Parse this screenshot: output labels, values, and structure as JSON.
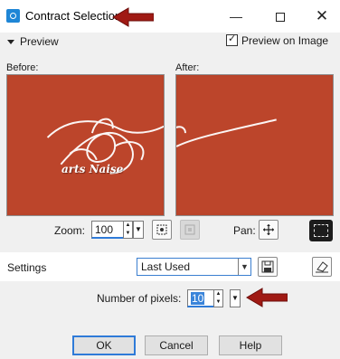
{
  "window": {
    "title": "Contract Selection",
    "minimize_glyph": "—",
    "close_glyph": "✕"
  },
  "preview": {
    "toggle_label": "Preview",
    "preview_on_image_label": "Preview on Image",
    "preview_on_image_checked": true
  },
  "panels": {
    "before_label": "Before:",
    "after_label": "After:",
    "watermark_text": "arts Naise",
    "image_color": "#bc452b"
  },
  "zoom": {
    "label": "Zoom:",
    "value": "100",
    "pan_label": "Pan:"
  },
  "settings": {
    "label": "Settings",
    "preset_value": "Last Used"
  },
  "params": {
    "pixels_label": "Number of pixels:",
    "pixels_value": "10"
  },
  "buttons": {
    "ok": "OK",
    "cancel": "Cancel",
    "help": "Help"
  },
  "annotation_color": "#a01a14"
}
